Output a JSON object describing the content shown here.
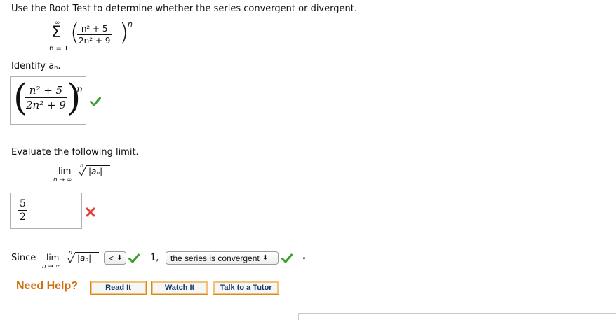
{
  "question": {
    "prompt": "Use the Root Test to determine whether the series convergent or divergent.",
    "series": {
      "sum_symbol": "Σ",
      "upper_limit": "∞",
      "lower_limit": "n = 1",
      "numerator": "n² + 5",
      "denominator": "2n² + 9",
      "exponent": "n"
    }
  },
  "step1": {
    "label": "Identify aₙ.",
    "answer": {
      "numerator": "n² + 5",
      "denominator": "2n² + 9",
      "exponent": "n"
    },
    "status": "correct"
  },
  "step2": {
    "label": "Evaluate the following limit.",
    "limit": {
      "lim": "lim",
      "sub": "n → ∞",
      "root_index": "n",
      "radicand": "|aₙ|"
    },
    "answer": {
      "numerator": "5",
      "denominator": "2"
    },
    "status": "incorrect"
  },
  "step3": {
    "since": "Since",
    "lim": "lim",
    "sub": "n → ∞",
    "root_index": "n",
    "radicand": "|aₙ|",
    "comparison": {
      "selected": "<",
      "arrows": "⬍"
    },
    "comparison_status": "correct",
    "value": "1,",
    "conclusion": {
      "selected": "the series is convergent",
      "arrows": "⬍"
    },
    "conclusion_status": "correct",
    "period": "."
  },
  "help": {
    "label": "Need Help?",
    "buttons": [
      "Read It",
      "Watch It",
      "Talk to a Tutor"
    ]
  },
  "colors": {
    "check": "#3aa02c",
    "cross": "#e0413a",
    "accent": "#d26f0e",
    "button_border": "#d98a1e"
  }
}
